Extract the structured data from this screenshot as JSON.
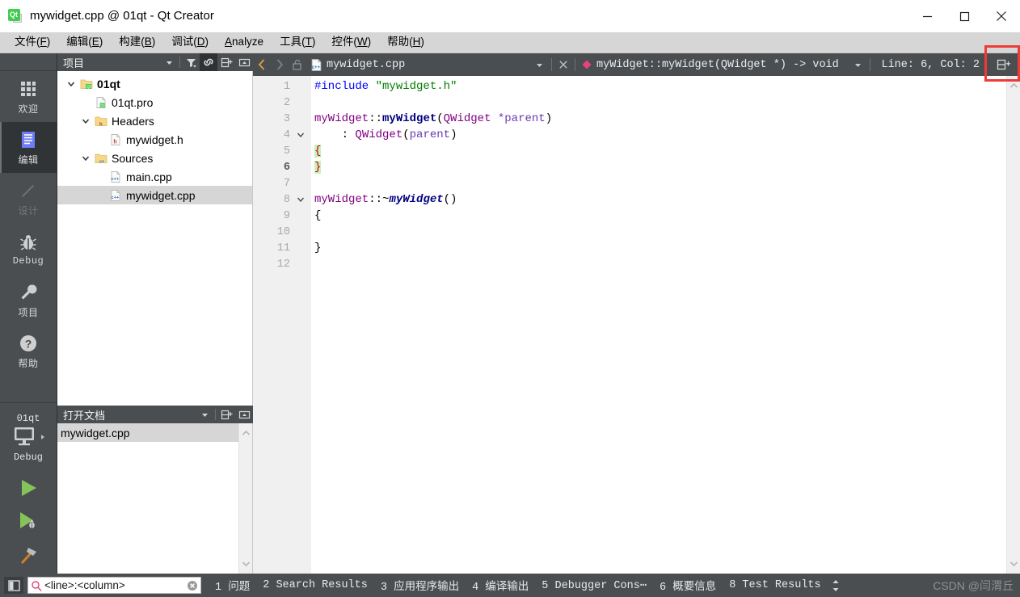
{
  "window": {
    "title": "mywidget.cpp @ 01qt - Qt Creator",
    "app_icon": "qt-creator-icon",
    "minimize_label": "—",
    "maximize_label": "□",
    "close_label": "✕"
  },
  "menubar": {
    "items": [
      {
        "label": "文件(F)",
        "mnemonic": "F",
        "name": "menu-file"
      },
      {
        "label": "编辑(E)",
        "mnemonic": "E",
        "name": "menu-edit"
      },
      {
        "label": "构建(B)",
        "mnemonic": "B",
        "name": "menu-build"
      },
      {
        "label": "调试(D)",
        "mnemonic": "D",
        "name": "menu-debug"
      },
      {
        "label": "Analyze",
        "mnemonic": "A",
        "name": "menu-analyze"
      },
      {
        "label": "工具(T)",
        "mnemonic": "T",
        "name": "menu-tools"
      },
      {
        "label": "控件(W)",
        "mnemonic": "W",
        "name": "menu-window"
      },
      {
        "label": "帮助(H)",
        "mnemonic": "H",
        "name": "menu-help"
      }
    ]
  },
  "modebar": {
    "items": [
      {
        "label": "欢迎",
        "icon": "grid-icon",
        "active": false,
        "disabled": false
      },
      {
        "label": "编辑",
        "icon": "document-lines-icon",
        "active": true,
        "disabled": false
      },
      {
        "label": "设计",
        "icon": "pencil-icon",
        "active": false,
        "disabled": true
      },
      {
        "label": "Debug",
        "icon": "bug-icon",
        "active": false,
        "disabled": false
      },
      {
        "label": "项目",
        "icon": "wrench-icon",
        "active": false,
        "disabled": false
      },
      {
        "label": "帮助",
        "icon": "question-circle-icon",
        "active": false,
        "disabled": false
      }
    ],
    "kit": {
      "project_name": "01qt",
      "build_config": "Debug",
      "target_icon": "desktop-monitor-icon",
      "run_label": "run-button",
      "debug_label": "run-debug-button",
      "build_label": "build-hammer-button"
    }
  },
  "project_dock": {
    "title": "项目",
    "tools": [
      {
        "name": "filter-dropdown-arrow",
        "icon": "chevron-down-icon",
        "active": false
      },
      {
        "name": "filter-tree-button",
        "icon": "filter-icon",
        "active": false
      },
      {
        "name": "sync-with-editor-button",
        "icon": "link-icon",
        "active": true
      },
      {
        "name": "split-dock-button",
        "icon": "split-icon",
        "active": false
      },
      {
        "name": "close-dock-button",
        "icon": "minimize-dock-icon",
        "active": false
      }
    ],
    "tree": [
      {
        "label": "01qt",
        "depth": 0,
        "icon": "qt-project-folder-icon",
        "chevron": "down",
        "bold": true,
        "selected": false
      },
      {
        "label": "01qt.pro",
        "depth": 1,
        "icon": "qt-pro-file-icon",
        "chevron": "none",
        "bold": false,
        "selected": false
      },
      {
        "label": "Headers",
        "depth": 1,
        "icon": "headers-folder-icon",
        "chevron": "down",
        "bold": false,
        "selected": false
      },
      {
        "label": "mywidget.h",
        "depth": 2,
        "icon": "h-file-icon",
        "chevron": "none",
        "bold": false,
        "selected": false
      },
      {
        "label": "Sources",
        "depth": 1,
        "icon": "sources-folder-icon",
        "chevron": "down",
        "bold": false,
        "selected": false
      },
      {
        "label": "main.cpp",
        "depth": 2,
        "icon": "cpp-file-icon",
        "chevron": "none",
        "bold": false,
        "selected": false
      },
      {
        "label": "mywidget.cpp",
        "depth": 2,
        "icon": "cpp-file-icon",
        "chevron": "none",
        "bold": false,
        "selected": true
      }
    ]
  },
  "opendocs_dock": {
    "title": "打开文档",
    "tools": [
      {
        "name": "opendocs-dropdown-arrow",
        "icon": "chevron-down-icon"
      },
      {
        "name": "opendocs-split-button",
        "icon": "split-icon"
      },
      {
        "name": "opendocs-close-button",
        "icon": "minimize-dock-icon"
      }
    ],
    "items": [
      {
        "label": "mywidget.cpp",
        "selected": true
      }
    ]
  },
  "editor_toolbar": {
    "back_label": "‹",
    "forward_label": "›",
    "lock_icon": "unlocked-padlock-icon",
    "file_icon": "cpp-file-icon",
    "file_name": "mywidget.cpp",
    "file_dropdown_icon": "chevron-down-icon",
    "close_icon": "close-icon",
    "symbol_icon": "function-diamond-icon",
    "symbol_text": "myWidget::myWidget(QWidget *) -> void",
    "symbol_dropdown_icon": "chevron-down-icon",
    "cursor_position": "Line: 6, Col: 2",
    "split_button_icon": "split-editor-icon"
  },
  "annotation": {
    "highlight_target": "split-editor-button",
    "color": "#ef3b36"
  },
  "code": {
    "language": "cpp",
    "current_line": 6,
    "lines": [
      {
        "n": 1,
        "fold": "none",
        "current": false,
        "tokens": [
          {
            "t": "#include ",
            "c": "tok-pre"
          },
          {
            "t": "\"mywidget.h\"",
            "c": "tok-str"
          }
        ]
      },
      {
        "n": 2,
        "fold": "none",
        "current": false,
        "tokens": []
      },
      {
        "n": 3,
        "fold": "none",
        "current": false,
        "tokens": [
          {
            "t": "myWidget",
            "c": "tok-type"
          },
          {
            "t": "::",
            "c": "tok-op"
          },
          {
            "t": "myWidget",
            "c": "tok-fn-decl"
          },
          {
            "t": "(",
            "c": "tok-op"
          },
          {
            "t": "QWidget ",
            "c": "tok-type"
          },
          {
            "t": "*parent",
            "c": "tok-param"
          },
          {
            "t": ")",
            "c": "tok-op"
          }
        ]
      },
      {
        "n": 4,
        "fold": "down",
        "current": false,
        "tokens": [
          {
            "t": "    : ",
            "c": "tok-op"
          },
          {
            "t": "QWidget",
            "c": "tok-type"
          },
          {
            "t": "(",
            "c": "tok-op"
          },
          {
            "t": "parent",
            "c": "tok-param"
          },
          {
            "t": ")",
            "c": "tok-op"
          }
        ]
      },
      {
        "n": 5,
        "fold": "none",
        "current": false,
        "tokens": [
          {
            "t": "{",
            "c": "brace-hl"
          }
        ]
      },
      {
        "n": 6,
        "fold": "none",
        "current": true,
        "tokens": [
          {
            "t": "}",
            "c": "brace-hl"
          }
        ]
      },
      {
        "n": 7,
        "fold": "none",
        "current": false,
        "tokens": []
      },
      {
        "n": 8,
        "fold": "down",
        "current": false,
        "tokens": [
          {
            "t": "myWidget",
            "c": "tok-type"
          },
          {
            "t": "::~",
            "c": "tok-op"
          },
          {
            "t": "myWidget",
            "c": "tok-fn-dtor"
          },
          {
            "t": "()",
            "c": "tok-op"
          }
        ]
      },
      {
        "n": 9,
        "fold": "none",
        "current": false,
        "tokens": [
          {
            "t": "{",
            "c": "tok-op"
          }
        ]
      },
      {
        "n": 10,
        "fold": "none",
        "current": false,
        "tokens": []
      },
      {
        "n": 11,
        "fold": "none",
        "current": false,
        "tokens": [
          {
            "t": "}",
            "c": "tok-op"
          }
        ]
      },
      {
        "n": 12,
        "fold": "none",
        "current": false,
        "tokens": []
      }
    ]
  },
  "statusbar": {
    "sidebar_toggle_icon": "toggle-sidebar-icon",
    "locator": {
      "search_icon": "search-icon",
      "value": "",
      "placeholder": "<line>:<column>",
      "clear_icon": "clear-circle-icon"
    },
    "panes": [
      {
        "num": "1",
        "label": "问题"
      },
      {
        "num": "2",
        "label": "Search Results"
      },
      {
        "num": "3",
        "label": "应用程序输出"
      },
      {
        "num": "4",
        "label": "编译输出"
      },
      {
        "num": "5",
        "label": "Debugger Cons⋯"
      },
      {
        "num": "6",
        "label": "概要信息"
      },
      {
        "num": "8",
        "label": "Test Results"
      }
    ],
    "spin_icon": "up-down-arrows-icon",
    "watermark": "CSDN @闫渭丘"
  }
}
